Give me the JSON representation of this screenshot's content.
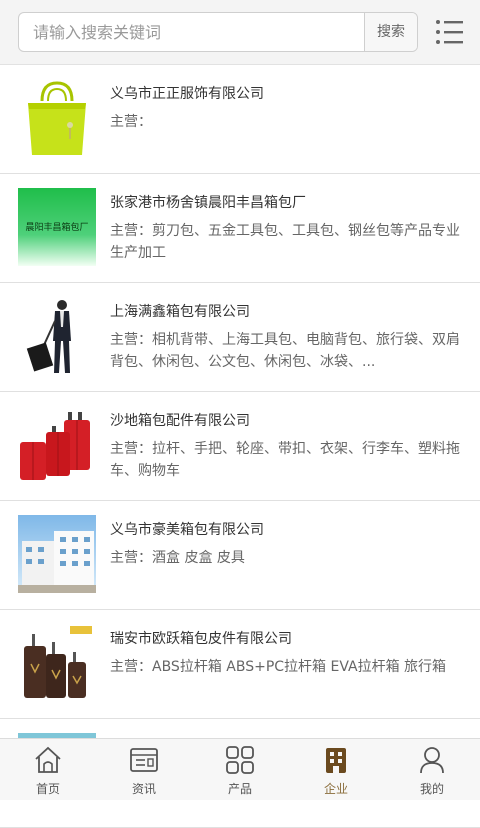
{
  "search": {
    "placeholder": "请输入搜索关键词",
    "button_label": "搜索"
  },
  "companies": [
    {
      "name": "义乌市正正服饰有限公司",
      "desc": "主营：",
      "thumb": "lime-handbag"
    },
    {
      "name": "张家港市杨舍镇晨阳丰昌箱包厂",
      "desc": "主营：剪刀包、五金工具包、工具包、钢丝包等产品专业生产加工",
      "thumb": "green-banner",
      "thumb_text": "晨阳丰昌箱包厂"
    },
    {
      "name": "上海满鑫箱包有限公司",
      "desc": "主营：相机背带、上海工具包、电脑背包、旅行袋、双肩背包、休闲包、公文包、休闲包、冰袋、...",
      "thumb": "man-with-trolley"
    },
    {
      "name": "沙地箱包配件有限公司",
      "desc": "主营：拉杆、手把、轮座、带扣、衣架、行李车、塑料拖车、购物车",
      "thumb": "red-suitcases"
    },
    {
      "name": "义乌市豪美箱包有限公司",
      "desc": "主营：酒盒 皮盒 皮具",
      "thumb": "factory-building"
    },
    {
      "name": "瑞安市欧跃箱包皮件有限公司",
      "desc": "主营：ABS拉杆箱 ABS+PC拉杆箱 EVA拉杆箱 旅行箱",
      "thumb": "brown-suitcases"
    }
  ],
  "tabbar": {
    "items": [
      {
        "label": "首页",
        "icon": "home-icon"
      },
      {
        "label": "资讯",
        "icon": "news-icon"
      },
      {
        "label": "产品",
        "icon": "grid-icon"
      },
      {
        "label": "企业",
        "icon": "building-icon",
        "active": true
      },
      {
        "label": "我的",
        "icon": "user-icon"
      }
    ]
  },
  "colors": {
    "active_tab": "#8a6d3b",
    "divider": "#e0e0e0",
    "topbar_bg": "#f4f4f4"
  }
}
